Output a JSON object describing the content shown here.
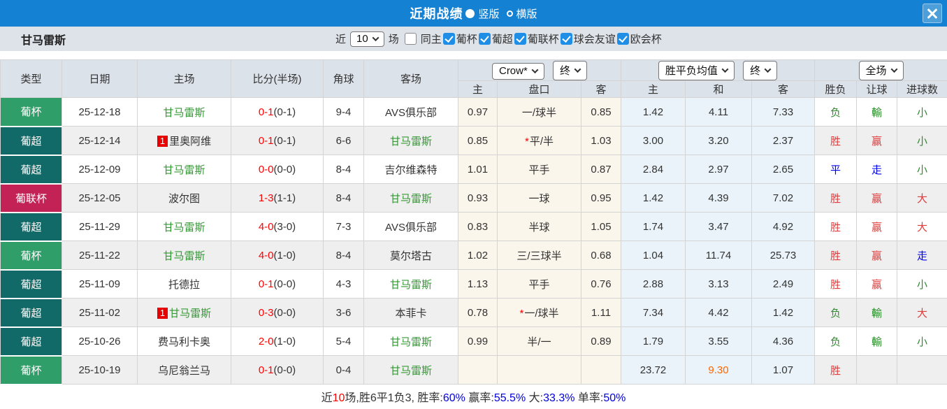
{
  "header": {
    "title": "近期战绩",
    "radio_vertical": "竖版",
    "radio_horizontal": "横版"
  },
  "filter": {
    "team": "甘马雷斯",
    "near_label": "近",
    "matches_value": "10",
    "matches_label": "场",
    "same_home_label": "同主",
    "leagues": [
      "葡杯",
      "葡超",
      "葡联杯",
      "球会友谊",
      "欧会杯"
    ]
  },
  "table": {
    "static_headers": [
      "类型",
      "日期",
      "主场",
      "比分(半场)",
      "角球",
      "客场"
    ],
    "dropdowns": {
      "odds_company": "Crow*",
      "odds_time_ah": "终",
      "europe_label": "胜平负均值",
      "odds_time_eu": "终",
      "scope": "全场"
    },
    "sub_headers": [
      "主",
      "盘口",
      "客",
      "主",
      "和",
      "客",
      "胜负",
      "让球",
      "进球数"
    ],
    "rows": [
      {
        "type": "葡杯",
        "type_color": "green",
        "date": "25-12-18",
        "home": {
          "name": "甘马雷斯",
          "color": "green",
          "badge": ""
        },
        "score": "0-1",
        "half": "(0-1)",
        "corners": "9-4",
        "away": {
          "name": "AVS俱乐部",
          "color": "black",
          "badge": ""
        },
        "ah_home": "0.97",
        "ah_star": false,
        "ah_line": "一/球半",
        "ah_away": "0.85",
        "eu_home": "1.42",
        "eu_draw": "4.11",
        "eu_away": "7.33",
        "eu_draw_color": "black",
        "result_wdl": {
          "text": "负",
          "color": "green"
        },
        "result_ah": {
          "text": "輸",
          "color": "green"
        },
        "result_ou": {
          "text": "小",
          "color": "green"
        }
      },
      {
        "type": "葡超",
        "type_color": "teal",
        "date": "25-12-14",
        "home": {
          "name": "里奥阿维",
          "color": "black",
          "badge": "1"
        },
        "score": "0-1",
        "half": "(0-1)",
        "corners": "6-6",
        "away": {
          "name": "甘马雷斯",
          "color": "green",
          "badge": ""
        },
        "ah_home": "0.85",
        "ah_star": true,
        "ah_line": "平/半",
        "ah_away": "1.03",
        "eu_home": "3.00",
        "eu_draw": "3.20",
        "eu_away": "2.37",
        "eu_draw_color": "black",
        "result_wdl": {
          "text": "胜",
          "color": "red"
        },
        "result_ah": {
          "text": "赢",
          "color": "red"
        },
        "result_ou": {
          "text": "小",
          "color": "green"
        }
      },
      {
        "type": "葡超",
        "type_color": "teal",
        "date": "25-12-09",
        "home": {
          "name": "甘马雷斯",
          "color": "green",
          "badge": ""
        },
        "score": "0-0",
        "half": "(0-0)",
        "corners": "8-4",
        "away": {
          "name": "吉尔维森特",
          "color": "black",
          "badge": ""
        },
        "ah_home": "1.01",
        "ah_star": false,
        "ah_line": "平手",
        "ah_away": "0.87",
        "eu_home": "2.84",
        "eu_draw": "2.97",
        "eu_away": "2.65",
        "eu_draw_color": "black",
        "result_wdl": {
          "text": "平",
          "color": "blue"
        },
        "result_ah": {
          "text": "走",
          "color": "blue"
        },
        "result_ou": {
          "text": "小",
          "color": "green"
        }
      },
      {
        "type": "葡联杯",
        "type_color": "crimson",
        "date": "25-12-05",
        "home": {
          "name": "波尔图",
          "color": "black",
          "badge": ""
        },
        "score": "1-3",
        "half": "(1-1)",
        "corners": "8-4",
        "away": {
          "name": "甘马雷斯",
          "color": "green",
          "badge": ""
        },
        "ah_home": "0.93",
        "ah_star": false,
        "ah_line": "一球",
        "ah_away": "0.95",
        "eu_home": "1.42",
        "eu_draw": "4.39",
        "eu_away": "7.02",
        "eu_draw_color": "black",
        "result_wdl": {
          "text": "胜",
          "color": "red"
        },
        "result_ah": {
          "text": "赢",
          "color": "red"
        },
        "result_ou": {
          "text": "大",
          "color": "red"
        }
      },
      {
        "type": "葡超",
        "type_color": "teal",
        "date": "25-11-29",
        "home": {
          "name": "甘马雷斯",
          "color": "green",
          "badge": ""
        },
        "score": "4-0",
        "half": "(3-0)",
        "corners": "7-3",
        "away": {
          "name": "AVS俱乐部",
          "color": "black",
          "badge": ""
        },
        "ah_home": "0.83",
        "ah_star": false,
        "ah_line": "半球",
        "ah_away": "1.05",
        "eu_home": "1.74",
        "eu_draw": "3.47",
        "eu_away": "4.92",
        "eu_draw_color": "black",
        "result_wdl": {
          "text": "胜",
          "color": "red"
        },
        "result_ah": {
          "text": "赢",
          "color": "red"
        },
        "result_ou": {
          "text": "大",
          "color": "red"
        }
      },
      {
        "type": "葡杯",
        "type_color": "green",
        "date": "25-11-22",
        "home": {
          "name": "甘马雷斯",
          "color": "green",
          "badge": ""
        },
        "score": "4-0",
        "half": "(1-0)",
        "corners": "8-4",
        "away": {
          "name": "莫尔塔古",
          "color": "black",
          "badge": ""
        },
        "ah_home": "1.02",
        "ah_star": false,
        "ah_line": "三/三球半",
        "ah_away": "0.68",
        "eu_home": "1.04",
        "eu_draw": "11.74",
        "eu_away": "25.73",
        "eu_draw_color": "black",
        "result_wdl": {
          "text": "胜",
          "color": "red"
        },
        "result_ah": {
          "text": "赢",
          "color": "red"
        },
        "result_ou": {
          "text": "走",
          "color": "blue"
        }
      },
      {
        "type": "葡超",
        "type_color": "teal",
        "date": "25-11-09",
        "home": {
          "name": "托德拉",
          "color": "black",
          "badge": ""
        },
        "score": "0-1",
        "half": "(0-0)",
        "corners": "4-3",
        "away": {
          "name": "甘马雷斯",
          "color": "green",
          "badge": ""
        },
        "ah_home": "1.13",
        "ah_star": false,
        "ah_line": "平手",
        "ah_away": "0.76",
        "eu_home": "2.88",
        "eu_draw": "3.13",
        "eu_away": "2.49",
        "eu_draw_color": "black",
        "result_wdl": {
          "text": "胜",
          "color": "red"
        },
        "result_ah": {
          "text": "赢",
          "color": "red"
        },
        "result_ou": {
          "text": "小",
          "color": "green"
        }
      },
      {
        "type": "葡超",
        "type_color": "teal",
        "date": "25-11-02",
        "home": {
          "name": "甘马雷斯",
          "color": "green",
          "badge": "1"
        },
        "score": "0-3",
        "half": "(0-0)",
        "corners": "3-6",
        "away": {
          "name": "本菲卡",
          "color": "black",
          "badge": ""
        },
        "ah_home": "0.78",
        "ah_star": true,
        "ah_line": "一/球半",
        "ah_away": "1.11",
        "eu_home": "7.34",
        "eu_draw": "4.42",
        "eu_away": "1.42",
        "eu_draw_color": "black",
        "result_wdl": {
          "text": "负",
          "color": "green"
        },
        "result_ah": {
          "text": "輸",
          "color": "green"
        },
        "result_ou": {
          "text": "大",
          "color": "red"
        }
      },
      {
        "type": "葡超",
        "type_color": "teal",
        "date": "25-10-26",
        "home": {
          "name": "费马利卡奥",
          "color": "black",
          "badge": ""
        },
        "score": "2-0",
        "half": "(1-0)",
        "corners": "5-4",
        "away": {
          "name": "甘马雷斯",
          "color": "green",
          "badge": ""
        },
        "ah_home": "0.99",
        "ah_star": false,
        "ah_line": "半/一",
        "ah_away": "0.89",
        "eu_home": "1.79",
        "eu_draw": "3.55",
        "eu_away": "4.36",
        "eu_draw_color": "black",
        "result_wdl": {
          "text": "负",
          "color": "green"
        },
        "result_ah": {
          "text": "輸",
          "color": "green"
        },
        "result_ou": {
          "text": "小",
          "color": "green"
        }
      },
      {
        "type": "葡杯",
        "type_color": "green",
        "date": "25-10-19",
        "home": {
          "name": "乌尼翁兰马",
          "color": "black",
          "badge": ""
        },
        "score": "0-1",
        "half": "(0-0)",
        "corners": "0-4",
        "away": {
          "name": "甘马雷斯",
          "color": "green",
          "badge": ""
        },
        "ah_home": "",
        "ah_star": false,
        "ah_line": "",
        "ah_away": "",
        "eu_home": "23.72",
        "eu_draw": "9.30",
        "eu_away": "1.07",
        "eu_draw_color": "orange",
        "result_wdl": {
          "text": "胜",
          "color": "red"
        },
        "result_ah": {
          "text": "",
          "color": "black"
        },
        "result_ou": {
          "text": "",
          "color": "black"
        }
      }
    ]
  },
  "footer": {
    "segments": [
      {
        "text": "近",
        "color": "black"
      },
      {
        "text": "10",
        "color": "red"
      },
      {
        "text": "场,胜6平1负3, 胜率:",
        "color": "black"
      },
      {
        "text": "60%",
        "color": "blue"
      },
      {
        "text": " 赢率:",
        "color": "black"
      },
      {
        "text": "55.5%",
        "color": "blue"
      },
      {
        "text": " 大:",
        "color": "black"
      },
      {
        "text": "33.3%",
        "color": "blue"
      },
      {
        "text": " 单率:",
        "color": "black"
      },
      {
        "text": "50%",
        "color": "blue"
      }
    ]
  },
  "colors": {
    "titlebar_blue": "#1581d3",
    "checkbox_blue": "#1e8ee6",
    "cup_green": "#2f9e68",
    "league_teal": "#116a68",
    "leaguecup_crimson": "#c32257",
    "score_red": "#ff0000",
    "team_green": "#339933",
    "result_red": "#e03c3c",
    "result_green": "#2e8b2e",
    "result_blue": "#0000f0",
    "highlight_orange": "#ff6600",
    "footer_blue": "#0000dd"
  }
}
